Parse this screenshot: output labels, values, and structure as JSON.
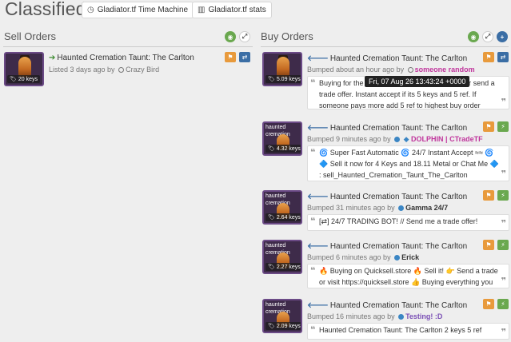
{
  "header": {
    "title": "Classifieds",
    "buttons": [
      {
        "label": "Gladiator.tf Time Machine",
        "icon": "clock-icon"
      },
      {
        "label": "Gladiator.tf stats",
        "icon": "bar-chart-icon"
      }
    ]
  },
  "sell": {
    "title": "Sell Orders",
    "listings": [
      {
        "name": "Haunted Cremation Taunt: The Carlton",
        "price": "20 keys",
        "meta": "Listed 3 days ago by",
        "user": "Crazy Bird",
        "user_color": "#777777"
      }
    ]
  },
  "buy": {
    "title": "Buy Orders",
    "tooltip": "Fri, 07 Aug 26 13:43:24 +0000",
    "listings": [
      {
        "name": "Haunted Cremation Taunt: The Carlton",
        "price": "5.09 keys",
        "meta": "Bumped about an hour ago by",
        "user": "someone random",
        "user_color": "#c0359c",
        "thumb_caption": "",
        "comment": "Buying for the … n other users and bots. Add or send a trade offer. Instant accept if its 5 keys and 5 ref. If someone pays more add 5 ref to highest buy order"
      },
      {
        "name": "Haunted Cremation Taunt: The Carlton",
        "price": "4.32 keys",
        "meta": "Bumped 9 minutes ago by",
        "user": "DOLPHIN | CTradeTF",
        "user_color": "#c0359c",
        "thumb_caption": "haunted cremation",
        "comment": "🌀 Super Fast Automatic 🌀 24/7 Instant Accept ≈≈ 🌀 🔷 Sell it now for 4 Keys and 18.11 Metal or Chat Me 🔷 : sell_Haunted_Cremation_Taunt_The_Carlton"
      },
      {
        "name": "Haunted Cremation Taunt: The Carlton",
        "price": "2.64 keys",
        "meta": "Bumped 31 minutes ago by",
        "user": "Gamma 24/7",
        "user_color": "#333333",
        "thumb_caption": "haunted cremation",
        "comment": "[⇄] 24/7 TRADING BOT! // Send me a trade offer!"
      },
      {
        "name": "Haunted Cremation Taunt: The Carlton",
        "price": "2.27 keys",
        "meta": "Bumped 6 minutes ago by",
        "user": "Erick",
        "user_color": "#333333",
        "thumb_caption": "haunted cremation",
        "comment": "🔥 Buying on Quicksell.store 🔥 Sell it! 👉 Send a trade or visit https://quicksell.store 👍 Buying everything you have!"
      },
      {
        "name": "Haunted Cremation Taunt: The Carlton",
        "price": "2.09 keys",
        "meta": "Bumped 16 minutes ago by",
        "user": "Testing! :D",
        "user_color": "#7a4fb5",
        "thumb_caption": "haunted cremation",
        "comment": "Haunted Cremation Taunt: The Carlton 2 keys 5 ref"
      }
    ]
  }
}
